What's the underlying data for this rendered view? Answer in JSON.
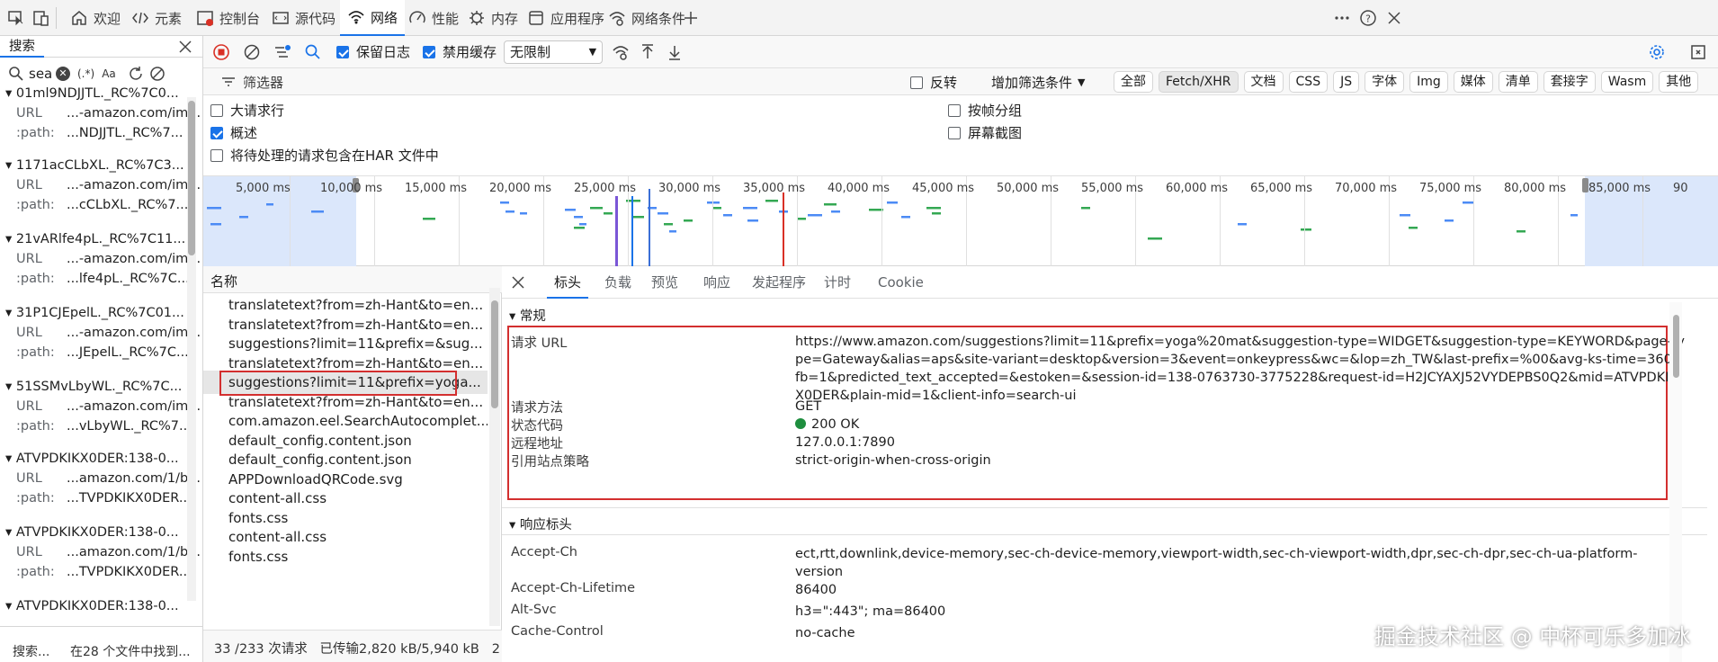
{
  "top_tabs": [
    {
      "label": "欢迎",
      "icon": "home-icon"
    },
    {
      "label": "元素",
      "icon": "code-icon"
    },
    {
      "label": "控制台",
      "icon": "console-icon"
    },
    {
      "label": "源代码",
      "icon": "sources-icon"
    },
    {
      "label": "网络",
      "icon": "wifi-icon",
      "active": true
    },
    {
      "label": "性能",
      "icon": "performance-icon"
    },
    {
      "label": "内存",
      "icon": "memory-icon"
    },
    {
      "label": "应用程序",
      "icon": "application-icon"
    },
    {
      "label": "网络条件",
      "icon": "network-conditions-icon"
    }
  ],
  "search": {
    "tab_label": "搜索",
    "query": "sea",
    "regex_label": "(.*)",
    "case_label": "Aa",
    "results": [
      {
        "title": "01ml9NDJJTL._RC%7C0...",
        "url": "...-amazon.com/im...",
        "path": "...NDJJTL._RC%7..."
      },
      {
        "title": "1171acCLbXL._RC%7C3...",
        "url": "...-amazon.com/im...",
        "path": "...cCLbXL._RC%7..."
      },
      {
        "title": "21vARlfe4pL._RC%7C11...",
        "url": "...-amazon.com/im...",
        "path": "...lfe4pL._RC%7C..."
      },
      {
        "title": "31P1CJEpelL._RC%7C01...",
        "url": "...-amazon.com/im...",
        "path": "...JEpelL._RC%7C..."
      },
      {
        "title": "51SSMvLbyWL._RC%7C...",
        "url": "...-amazon.com/im...",
        "path": "...vLbyWL._RC%7..."
      },
      {
        "title": "ATVPDKIKX0DER:138-0...",
        "url": "...amazon.com/1/b...",
        "path": "...TVPDKIKX0DER..."
      },
      {
        "title": "ATVPDKIKX0DER:138-0...",
        "url": "...amazon.com/1/b...",
        "path": "...TVPDKIKX0DER..."
      },
      {
        "title": "ATVPDKIKX0DER:138-0...",
        "url": "",
        "path": ""
      }
    ],
    "url_key": "URL",
    "path_key": ":path:",
    "status_left": "搜索...",
    "status_right": "在28 个文件中找到..."
  },
  "toolbar": {
    "preserve_log": "保留日志",
    "disable_cache": "禁用缓存",
    "throttle": "无限制"
  },
  "filter": {
    "placeholder": "筛选器",
    "invert": "反转",
    "more_filters": "增加筛选条件",
    "chips": [
      "全部",
      "Fetch/XHR",
      "文档",
      "CSS",
      "JS",
      "字体",
      "Img",
      "媒体",
      "清单",
      "套接字",
      "Wasm",
      "其他"
    ],
    "active_chip": "Fetch/XHR"
  },
  "options": {
    "large_rows": "大请求行",
    "group_by_frame": "按帧分组",
    "overview": "概述",
    "screenshots": "屏幕截图",
    "har_pending": "将待处理的请求包含在HAR 文件中"
  },
  "timeline": {
    "ticks": [
      "5,000 ms",
      "10,000 ms",
      "15,000 ms",
      "20,000 ms",
      "25,000 ms",
      "30,000 ms",
      "35,000 ms",
      "40,000 ms",
      "45,000 ms",
      "50,000 ms",
      "55,000 ms",
      "60,000 ms",
      "65,000 ms",
      "70,000 ms",
      "75,000 ms",
      "80,000 ms",
      "85,000 ms",
      "90"
    ]
  },
  "requests": {
    "header": "名称",
    "rows": [
      "translatetext?from=zh-Hant&to=en...",
      "translatetext?from=zh-Hant&to=en...",
      "suggestions?limit=11&prefix=&sug...",
      "translatetext?from=zh-Hant&to=en...",
      "suggestions?limit=11&prefix=yoga...",
      "translatetext?from=zh-Hant&to=en...",
      "com.amazon.eel.SearchAutocomplet...",
      "default_config.content.json",
      "default_config.content.json",
      "APPDownloadQRCode.svg",
      "content-all.css",
      "fonts.css",
      "content-all.css",
      "fonts.css"
    ],
    "selected_index": 4,
    "status": "33 /233 次请求   已传输2,820 kB/5,940 kB   2,8"
  },
  "detail_tabs": [
    "标头",
    "负载",
    "预览",
    "响应",
    "发起程序",
    "计时",
    "Cookie"
  ],
  "general": {
    "section": "常规",
    "rows": [
      {
        "k": "请求 URL",
        "v": "https://www.amazon.com/suggestions?limit=11&prefix=yoga%20mat&suggestion-type=WIDGET&suggestion-type=KEYWORD&page-type=Gateway&alias=aps&site-variant=desktop&version=3&event=onkeypress&wc=&lop=zh_TW&last-prefix=%00&avg-ks-time=360&fb=1&predicted_text_accepted=&estoken=&session-id=138-0763730-3775228&request-id=H2JCYAXJ52VYDEPBS0Q2&mid=ATVPDKIKX0DER&plain-mid=1&client-info=search-ui"
      },
      {
        "k": "请求方法",
        "v": "GET"
      },
      {
        "k": "状态代码",
        "v": "200 OK"
      },
      {
        "k": "远程地址",
        "v": "127.0.0.1:7890"
      },
      {
        "k": "引用站点策略",
        "v": "strict-origin-when-cross-origin"
      }
    ]
  },
  "response_headers": {
    "section": "响应标头",
    "rows": [
      {
        "k": "Accept-Ch",
        "v": "ect,rtt,downlink,device-memory,sec-ch-device-memory,viewport-width,sec-ch-viewport-width,dpr,sec-ch-dpr,sec-ch-ua-platform-version"
      },
      {
        "k": "Accept-Ch-Lifetime",
        "v": "86400"
      },
      {
        "k": "Alt-Svc",
        "v": "h3=\":443\"; ma=86400"
      },
      {
        "k": "Cache-Control",
        "v": "no-cache"
      }
    ]
  },
  "watermark": "掘金技术社区 @ 中杯可乐多加冰",
  "colors": {
    "accent": "#1a73e8",
    "highlight_border": "#d32f2f",
    "status_ok": "#1e8e3e"
  }
}
